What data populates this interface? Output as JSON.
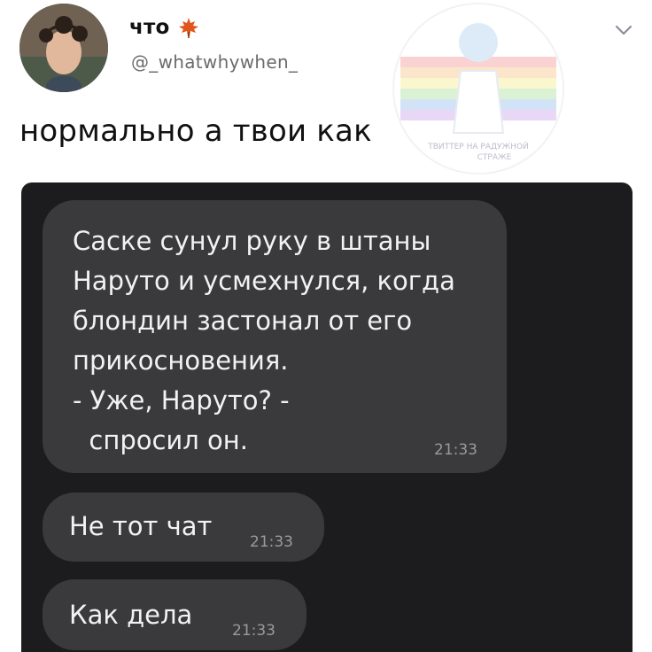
{
  "tweet": {
    "display_name": "что",
    "name_emoji_icon": "maple-leaf-icon",
    "handle": "@_whatwhywhen_",
    "text": "нормально а твои как",
    "menu_icon": "chevron-down-icon"
  },
  "watermark": {
    "line1": "ТВИТТЕР НА РАДУЖНОЙ",
    "line2": "СТРАЖЕ"
  },
  "chat": {
    "messages": [
      {
        "text": "Саске сунул руку в штаны\nНаруто и усмехнулся, когда\nблондин застонал от его\nприкосновения.\n- Уже, Наруто? -\n  спросил он.",
        "time": "21:33"
      },
      {
        "text": "Не тот чат",
        "time": "21:33"
      },
      {
        "text": "Как дела",
        "time": "21:33"
      }
    ]
  },
  "colors": {
    "chat_background": "#1c1c1e",
    "bubble": "#3a3a3c",
    "bubble_text": "#f2f2f2",
    "timestamp": "#9a9a9e",
    "handle": "#6b6b6b",
    "leaf": "#e0561b"
  }
}
